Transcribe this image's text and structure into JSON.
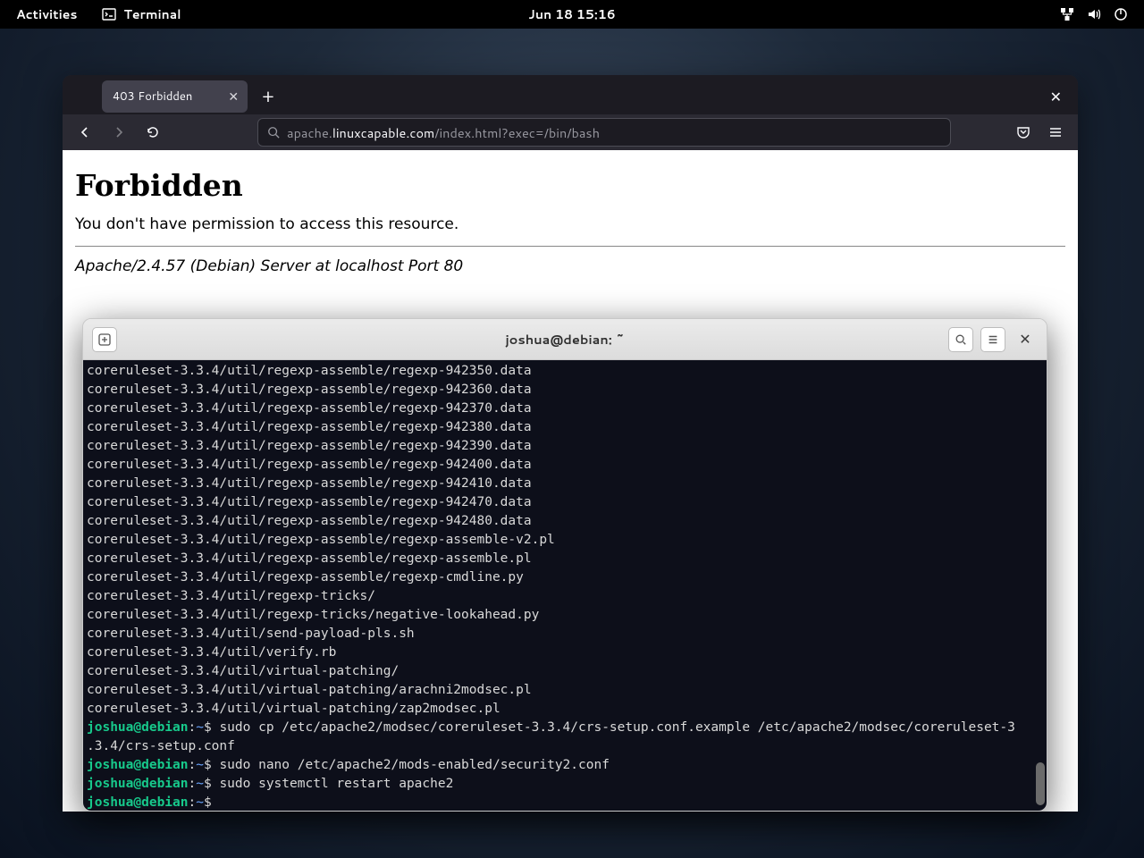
{
  "topbar": {
    "activities": "Activities",
    "app_label": "Terminal",
    "datetime": "Jun 18  15:16"
  },
  "browser": {
    "tab_title": "403 Forbidden",
    "url_dim_prefix": "apache.",
    "url_host": "linuxcapable.com",
    "url_rest": "/index.html?exec=/bin/bash",
    "page_h1": "Forbidden",
    "page_body": "You don't have permission to access this resource.",
    "page_footer": "Apache/2.4.57 (Debian) Server at localhost Port 80"
  },
  "terminal": {
    "title": "joshua@debian: ~",
    "user": "joshua@debian",
    "tilde": "~",
    "lines": [
      "coreruleset-3.3.4/util/regexp-assemble/regexp-942350.data",
      "coreruleset-3.3.4/util/regexp-assemble/regexp-942360.data",
      "coreruleset-3.3.4/util/regexp-assemble/regexp-942370.data",
      "coreruleset-3.3.4/util/regexp-assemble/regexp-942380.data",
      "coreruleset-3.3.4/util/regexp-assemble/regexp-942390.data",
      "coreruleset-3.3.4/util/regexp-assemble/regexp-942400.data",
      "coreruleset-3.3.4/util/regexp-assemble/regexp-942410.data",
      "coreruleset-3.3.4/util/regexp-assemble/regexp-942470.data",
      "coreruleset-3.3.4/util/regexp-assemble/regexp-942480.data",
      "coreruleset-3.3.4/util/regexp-assemble/regexp-assemble-v2.pl",
      "coreruleset-3.3.4/util/regexp-assemble/regexp-assemble.pl",
      "coreruleset-3.3.4/util/regexp-assemble/regexp-cmdline.py",
      "coreruleset-3.3.4/util/regexp-tricks/",
      "coreruleset-3.3.4/util/regexp-tricks/negative-lookahead.py",
      "coreruleset-3.3.4/util/send-payload-pls.sh",
      "coreruleset-3.3.4/util/verify.rb",
      "coreruleset-3.3.4/util/virtual-patching/",
      "coreruleset-3.3.4/util/virtual-patching/arachni2modsec.pl",
      "coreruleset-3.3.4/util/virtual-patching/zap2modsec.pl"
    ],
    "cmd1": "sudo cp /etc/apache2/modsec/coreruleset-3.3.4/crs-setup.conf.example /etc/apache2/modsec/coreruleset-3",
    "cmd1_wrap": ".3.4/crs-setup.conf",
    "cmd2": "sudo nano /etc/apache2/mods-enabled/security2.conf",
    "cmd3": "sudo systemctl restart apache2",
    "cmd4": ""
  }
}
